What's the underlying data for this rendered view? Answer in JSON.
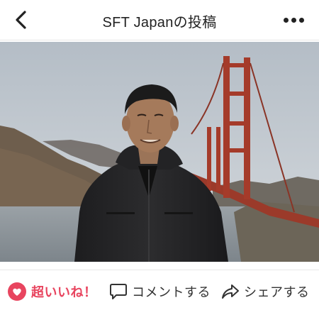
{
  "header": {
    "title": "SFT Japanの投稿",
    "back_icon": "chevron-left-icon",
    "more_icon": "more-dots-icon"
  },
  "photo": {
    "subject": "man-in-front-of-golden-gate-bridge"
  },
  "actions": {
    "like_label": "超いいね！",
    "like_icon": "heart-icon",
    "like_color": "#e8455f",
    "comment_label": "コメントする",
    "comment_icon": "comment-bubble-icon",
    "share_label": "シェアする",
    "share_icon": "share-arrow-icon"
  }
}
